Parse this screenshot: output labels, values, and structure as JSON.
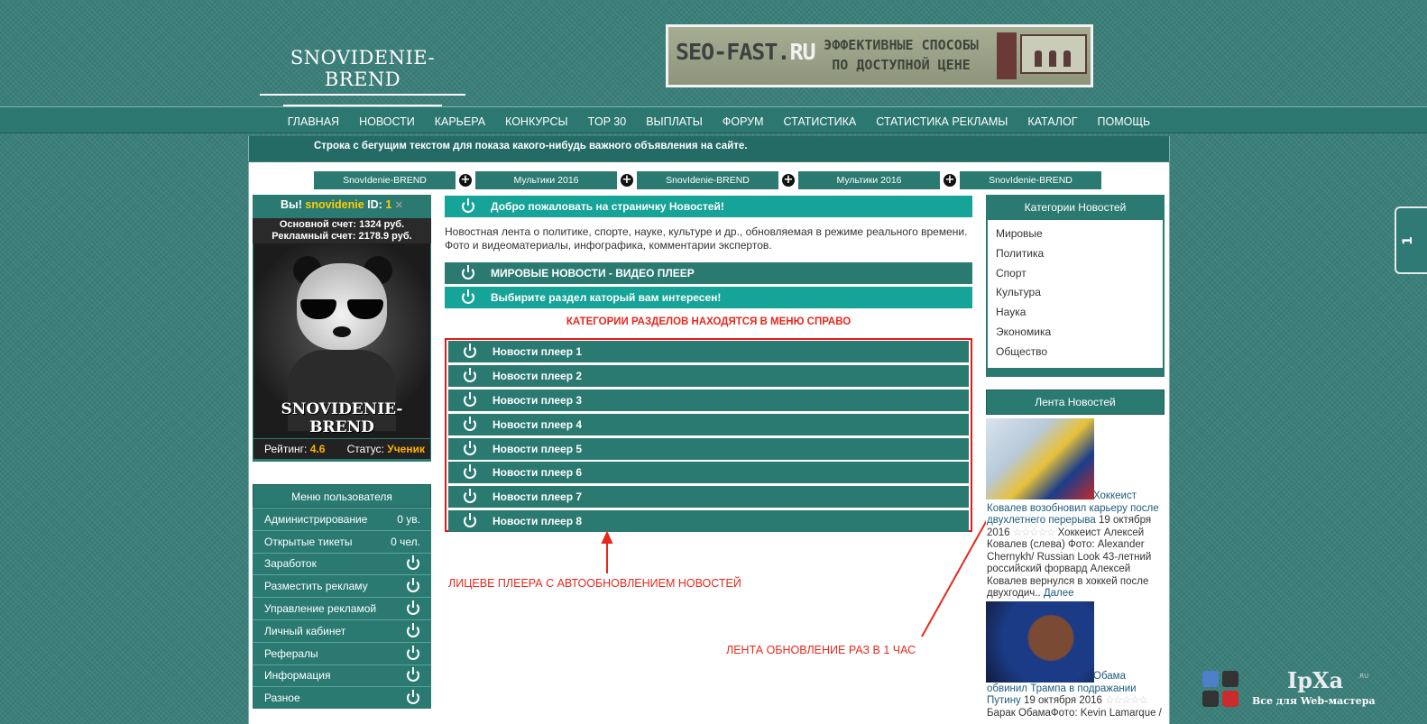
{
  "header": {
    "logo_text": "SNOVIDENIE-BREND",
    "banner": {
      "brand_dark": "SEO-FAST.",
      "brand_light": "RU",
      "line1": "ЭФФЕКТИВНЫЕ СПОСОБЫ",
      "line2": "ПО ДОСТУПНОЙ ЦЕНЕ"
    }
  },
  "nav": [
    "ГЛАВНАЯ",
    "НОВОСТИ",
    "КАРЬЕРА",
    "КОНКУРСЫ",
    "TOP 30",
    "ВЫПЛАТЫ",
    "ФОРУМ",
    "СТАТИСТИКА",
    "СТАТИСТИКА РЕКЛАМЫ",
    "КАТАЛОГ",
    "ПОМОЩЬ"
  ],
  "ticker": "Строка с бегущим текстом для показа какого-нибудь важного объявления на сайте.",
  "tabs": [
    "SnovIdenie-BREND",
    "Мультики 2016",
    "SnovIdenie-BREND",
    "Мультики 2016",
    "SnovIdenie-BREND"
  ],
  "user": {
    "greeting": "Вы!",
    "username": "snovidenie",
    "id_label": "ID:",
    "id_value": "1",
    "main_balance": "Основной счет: 1324 руб.",
    "ad_balance": "Рекламный счет: 2178.9 руб.",
    "avatar_caption": "SNOVIDENIE-BREND",
    "rating_label": "Рейтинг:",
    "rating_value": "4.6",
    "status_label": "Статус:",
    "status_value": "Ученик"
  },
  "user_menu": {
    "title": "Меню пользователя",
    "items": [
      {
        "label": "Администрирование",
        "value": "0 ув."
      },
      {
        "label": "Открытые тикеты",
        "value": "0 чел."
      },
      {
        "label": "Заработок",
        "value": ""
      },
      {
        "label": "Разместить рекламу",
        "value": ""
      },
      {
        "label": "Управление рекламой",
        "value": ""
      },
      {
        "label": "Личный кабинет",
        "value": ""
      },
      {
        "label": "Рефералы",
        "value": ""
      },
      {
        "label": "Информация",
        "value": ""
      },
      {
        "label": "Разное",
        "value": ""
      }
    ]
  },
  "center": {
    "welcome": "Добро пожаловать на страничку Новостей!",
    "intro": "Новостная лента о политике, спорте, науке, культуре и др., обновляемая в режиме реального времени. Фото и видеоматериалы, инфографика, комментарии экспертов.",
    "world_player": "МИРОВЫЕ НОВОСТИ - ВИДЕО ПЛЕЕР",
    "choose": "Выбирите раздел каторый вам интересен!",
    "categories_note": "КАТЕГОРИИ РАЗДЕЛОВ НАХОДЯТСЯ В МЕНЮ СПРАВО",
    "players": [
      "Новости плеер 1",
      "Новости плеер 2",
      "Новости плеер 3",
      "Новости плеер 4",
      "Новости плеер 5",
      "Новости плеер 6",
      "Новости плеер 7",
      "Новости плеер 8"
    ],
    "annotation_players": "ЛИЦЕВЕ ПЛЕЕРА С АВТООБНОВЛЕНИЕМ НОВОСТЕЙ",
    "annotation_feed": "ЛЕНТА ОБНОВЛЕНИЕ РАЗ В 1 ЧАС"
  },
  "categories": {
    "title": "Категории Новостей",
    "items": [
      "Мировые",
      "Политика",
      "Спорт",
      "Культура",
      "Наука",
      "Экономика",
      "Общество"
    ]
  },
  "feed": {
    "title": "Лента Новостей",
    "items": [
      {
        "headline": "Хоккеист Ковалев возобновил карьеру после двухлетнего перерыва",
        "date": "19 октября 2016",
        "stars": "☆☆☆☆☆",
        "body": "Хоккеист Алексей Ковалев (слева) Фото: Alexander Chernykh/ Russian Look 43-летний российский форвард Алексей Ковалев вернулся в хоккей после двухгодич..",
        "more": "Далее"
      },
      {
        "headline": "Обама обвинил Трампа в подражании Путину",
        "date": "19 октября 2016",
        "stars": "☆☆☆☆☆",
        "body": "Барак ОбамаФото: Kevin Lamarque /"
      }
    ]
  },
  "side_tab": "1",
  "watermark": {
    "brand": "IpXa",
    "suffix": ".RU",
    "tagline": "Все для Web-мастера"
  },
  "colors": {
    "teal": "#2b7a72",
    "teal_light": "#16a398",
    "accent_yellow": "#ffcc00",
    "annotation_red": "#e8281c"
  }
}
